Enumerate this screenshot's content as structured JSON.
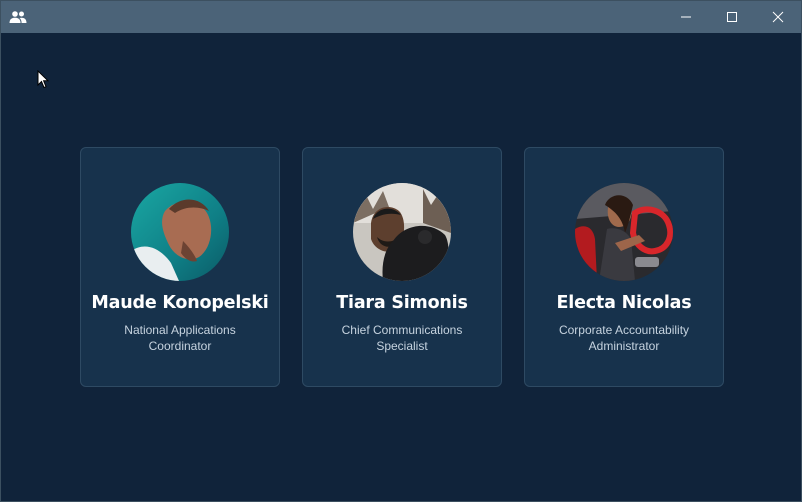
{
  "window": {
    "app_icon": "people-icon",
    "controls": {
      "minimize": "minimize-icon",
      "maximize": "maximize-icon",
      "close": "close-icon"
    }
  },
  "cards": [
    {
      "name": "Maude Konopelski",
      "role": "National Applications Coordinator"
    },
    {
      "name": "Tiara Simonis",
      "role": "Chief Communications Specialist"
    },
    {
      "name": "Electa Nicolas",
      "role": "Corporate Accountability Administrator"
    }
  ],
  "colors": {
    "background": "#10233a",
    "titlebar": "#4b6378",
    "card": "#17324c",
    "card_border": "#2e4a63",
    "name_text": "#ffffff",
    "role_text": "#c6d3df"
  }
}
